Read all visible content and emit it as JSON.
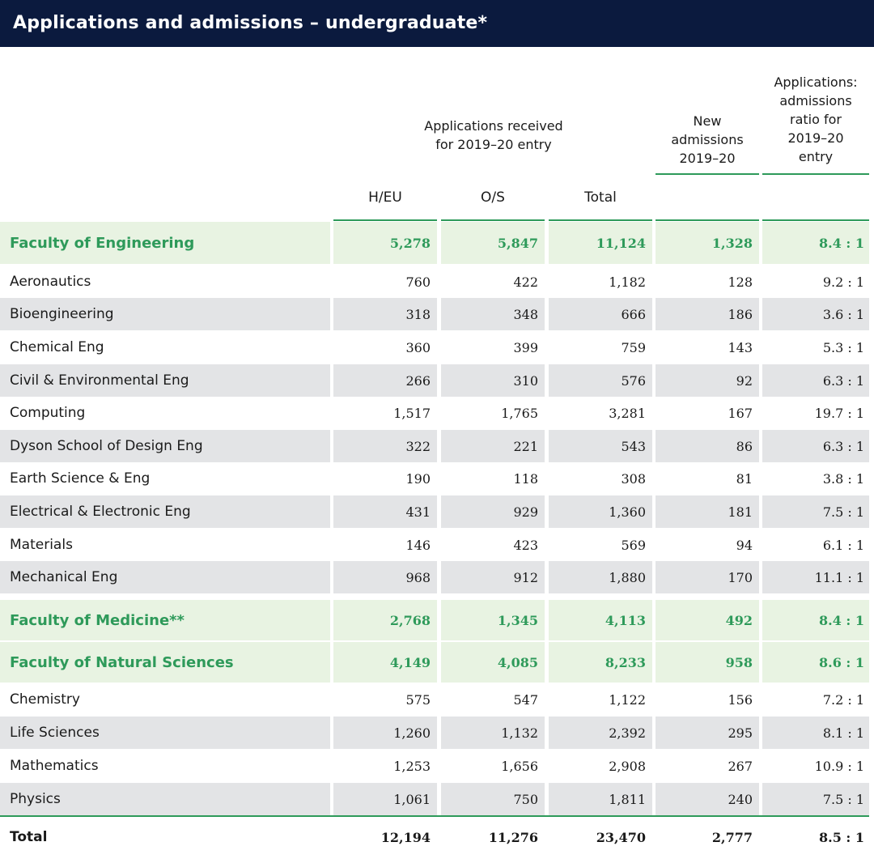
{
  "title": "Applications and admissions – undergraduate*",
  "headers": {
    "applications_received": [
      "Applications received",
      "for  2019–20 entry"
    ],
    "new_admissions": [
      "New",
      "admissions",
      "2019–20"
    ],
    "ratio": [
      "Applications:",
      "admissions",
      "ratio for",
      "2019–20",
      "entry"
    ],
    "hu_eu": "H/EU",
    "os": "O/S",
    "total": "Total"
  },
  "rows": [
    {
      "kind": "faculty",
      "label": "Faculty of Engineering",
      "hu_eu": "5,278",
      "os": "5,847",
      "total": "11,124",
      "new": "1,328",
      "ratio": "8.4 : 1"
    },
    {
      "kind": "plain",
      "label": "Aeronautics",
      "hu_eu": "760",
      "os": "422",
      "total": "1,182",
      "new": "128",
      "ratio": "9.2 : 1"
    },
    {
      "kind": "shaded",
      "label": "Bioengineering",
      "hu_eu": "318",
      "os": "348",
      "total": "666",
      "new": "186",
      "ratio": "3.6 : 1"
    },
    {
      "kind": "plain",
      "label": "Chemical Eng",
      "hu_eu": "360",
      "os": "399",
      "total": "759",
      "new": "143",
      "ratio": "5.3 : 1"
    },
    {
      "kind": "shaded",
      "label": "Civil & Environmental Eng",
      "hu_eu": "266",
      "os": "310",
      "total": "576",
      "new": "92",
      "ratio": "6.3 : 1"
    },
    {
      "kind": "plain",
      "label": "Computing",
      "hu_eu": "1,517",
      "os": "1,765",
      "total": "3,281",
      "new": "167",
      "ratio": "19.7 : 1"
    },
    {
      "kind": "shaded",
      "label": "Dyson School of Design Eng",
      "hu_eu": "322",
      "os": "221",
      "total": "543",
      "new": "86",
      "ratio": "6.3 : 1"
    },
    {
      "kind": "plain",
      "label": "Earth Science & Eng",
      "hu_eu": "190",
      "os": "118",
      "total": "308",
      "new": "81",
      "ratio": "3.8 : 1"
    },
    {
      "kind": "shaded",
      "label": "Electrical & Electronic Eng",
      "hu_eu": "431",
      "os": "929",
      "total": "1,360",
      "new": "181",
      "ratio": "7.5 : 1"
    },
    {
      "kind": "plain",
      "label": "Materials",
      "hu_eu": "146",
      "os": "423",
      "total": "569",
      "new": "94",
      "ratio": "6.1 : 1"
    },
    {
      "kind": "shaded",
      "label": "Mechanical Eng",
      "hu_eu": "968",
      "os": "912",
      "total": "1,880",
      "new": "170",
      "ratio": "11.1 : 1"
    },
    {
      "kind": "faculty",
      "label": "Faculty of Medicine**",
      "hu_eu": "2,768",
      "os": "1,345",
      "total": "4,113",
      "new": "492",
      "ratio": "8.4 : 1"
    },
    {
      "kind": "faculty",
      "label": "Faculty of Natural Sciences",
      "hu_eu": "4,149",
      "os": "4,085",
      "total": "8,233",
      "new": "958",
      "ratio": "8.6 : 1"
    },
    {
      "kind": "plain",
      "label": "Chemistry",
      "hu_eu": "575",
      "os": "547",
      "total": "1,122",
      "new": "156",
      "ratio": "7.2 : 1"
    },
    {
      "kind": "shaded",
      "label": "Life Sciences",
      "hu_eu": "1,260",
      "os": "1,132",
      "total": "2,392",
      "new": "295",
      "ratio": "8.1 : 1"
    },
    {
      "kind": "plain",
      "label": "Mathematics",
      "hu_eu": "1,253",
      "os": "1,656",
      "total": "2,908",
      "new": "267",
      "ratio": "10.9 : 1"
    },
    {
      "kind": "shaded",
      "label": "Physics",
      "hu_eu": "1,061",
      "os": "750",
      "total": "1,811",
      "new": "240",
      "ratio": "7.5 : 1"
    },
    {
      "kind": "total",
      "label": "Total",
      "hu_eu": "12,194",
      "os": "11,276",
      "total": "23,470",
      "new": "2,777",
      "ratio": "8.5 : 1"
    }
  ]
}
